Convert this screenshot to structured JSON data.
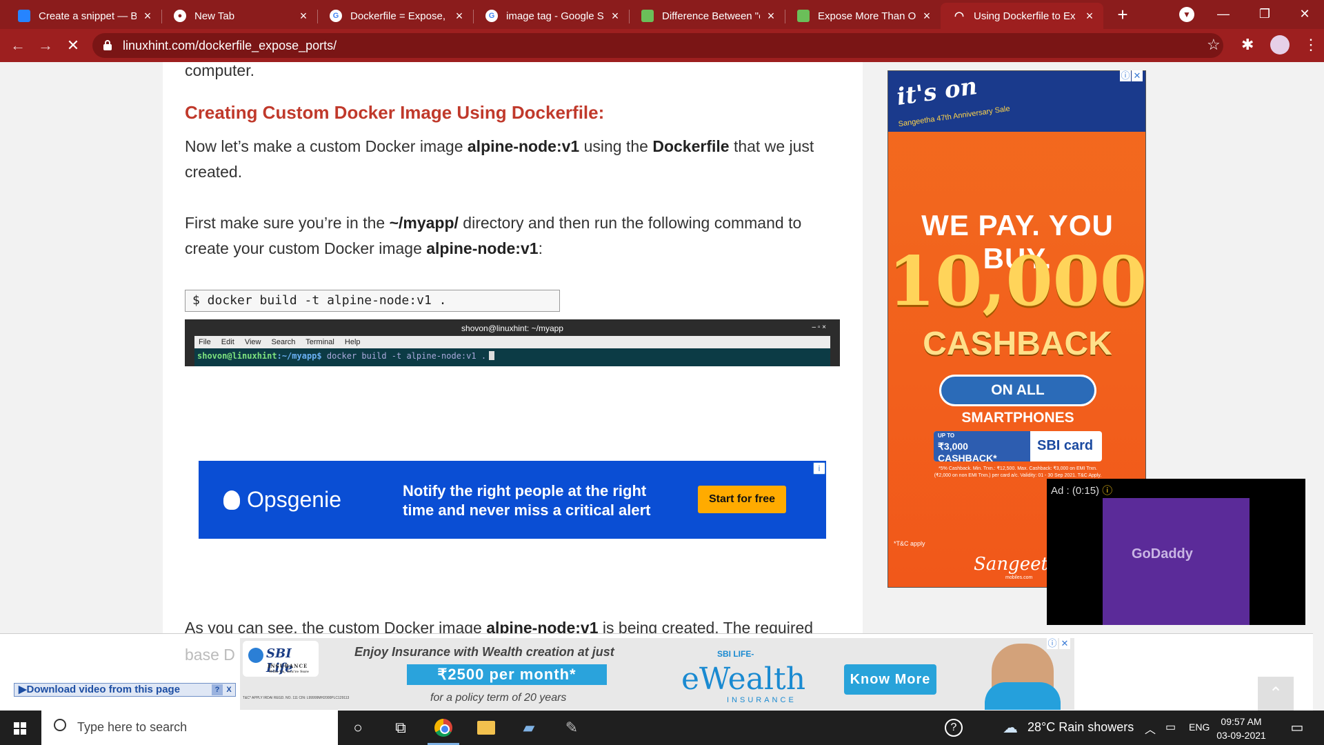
{
  "browser": {
    "tabs": [
      {
        "title": "Create a snippet — Bi",
        "favicon": "bitbucket-icon",
        "color": "#2684ff"
      },
      {
        "title": "New Tab",
        "favicon": "chrome-icon",
        "color": "#ffffff"
      },
      {
        "title": "Dockerfile = Expose, V",
        "favicon": "google-icon",
        "color": "#ffffff"
      },
      {
        "title": "image tag - Google Se",
        "favicon": "google-icon",
        "color": "#ffffff"
      },
      {
        "title": "Difference Between \"e",
        "favicon": "leaf-icon",
        "color": "#6bbf59"
      },
      {
        "title": "Expose More Than On",
        "favicon": "leaf-icon",
        "color": "#6bbf59"
      },
      {
        "title": "Using Dockerfile to Ex",
        "favicon": "loading-icon",
        "color": "#ffffff"
      }
    ],
    "url": "linuxhint.com/dockerfile_expose_ports/",
    "accent": "#9d1f1f"
  },
  "article": {
    "prev_line": "computer.",
    "heading": "Creating Custom Docker Image Using Dockerfile:",
    "para1": {
      "pre": "Now let’s make a custom Docker image ",
      "b1": "alpine-node:v1",
      "mid": " using the ",
      "b2": "Dockerfile",
      "post": " that we just created."
    },
    "para2": {
      "pre": "First make sure you’re in the ",
      "b1": "~/myapp/",
      "mid": " directory and then run the following command to create your custom Docker image ",
      "b2": "alpine-node:v1",
      "post": ":"
    },
    "code": "$ docker build -t alpine-node:v1 .",
    "terminal": {
      "title": "shovon@linuxhint: ~/myapp",
      "menu": [
        "File",
        "Edit",
        "View",
        "Search",
        "Terminal",
        "Help"
      ],
      "user": "shovon@linuxhint",
      "path": ":~/myapp$",
      "command": " docker build -t alpine-node:v1 ."
    },
    "para3": {
      "pre": "As you can see, the custom Docker image ",
      "b1": "alpine-node:v1",
      "post": " is being created. The required"
    },
    "para4_fragment": "base D"
  },
  "ads": {
    "opsgenie": {
      "brand": "Opsgenie",
      "tagline": "Notify the right people at the right time and never miss a critical alert",
      "cta": "Start for free"
    },
    "sangeetha": {
      "itson": "it's on",
      "sale": "Sangeetha 47th Anniversary Sale",
      "headline": "WE PAY. YOU BUY.",
      "amount": "10,000",
      "cashback": "CASHBACK",
      "pill": "ON ALL SMARTPHONES",
      "offer_upto": "UP TO",
      "offer_left": "₹3,000 CASHBACK*",
      "offer_right": "SBI card",
      "fine": "*5% Cashback. Min. Trxn.: ₹12,500. Max. Cashback: ₹3,000 on EMI Trxn. (₹2,000 on non EMI Trxn.) per card a/c. Validity: 01 - 30 Sep 2021. T&C Apply.",
      "tc": "*T&C apply",
      "brand": "Sangeetha",
      "brand_sub": "mobiles.com"
    },
    "video": {
      "label": "Ad : (0:15)",
      "brand": "GoDaddy"
    },
    "sbi": {
      "logo": "SBI Life",
      "logo_sub": "INSURANCE",
      "logo_tag": "With Us, You're Sure",
      "headline": "Enjoy Insurance with Wealth creation at just",
      "price": "₹2500 per month*",
      "term": "for a policy term of 20 years",
      "ew_sub": "SBI LIFE-",
      "ew_big": "eWealth",
      "ew_ins": "INSURANCE",
      "cta": "Know More",
      "legal": "T&C* APPLY IRDAI REGD. NO. 111 CIN: L99999MH2000PLC129113"
    },
    "download": "▶Download video from this page",
    "download_help": "?",
    "download_close": "X"
  },
  "taskbar": {
    "search_placeholder": "Type here to search",
    "weather": "28°C Rain showers",
    "lang": "ENG",
    "time": "09:57 AM",
    "date": "03-09-2021"
  }
}
